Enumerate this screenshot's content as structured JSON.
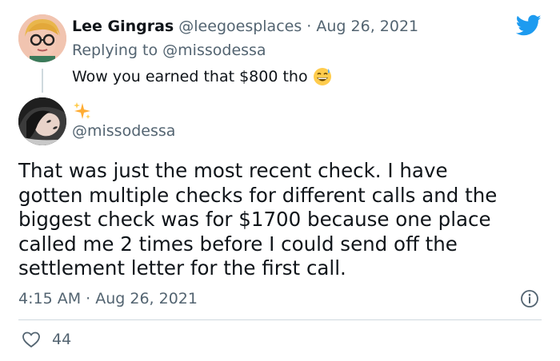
{
  "reply": {
    "name": "Lee Gingras",
    "handle": "@leegoesplaces",
    "separator": "·",
    "date": "Aug 26, 2021",
    "replying_prefix": "Replying to",
    "replying_to": "@missodessa",
    "text": "Wow you earned that $800 tho",
    "emoji": "grinning-sweat-emoji"
  },
  "main_tweet": {
    "display_name_icon": "sparkles-emoji",
    "handle": "@missodessa",
    "text_lines": [
      "That was just the most recent check.  I have",
      "gotten multiple checks for different calls and the",
      "biggest check was for $1700 because one place",
      "called me 2 times before I could send off the",
      "settlement letter for the first call."
    ],
    "timestamp": "4:15 AM · Aug 26, 2021",
    "likes_count": "44"
  },
  "icons": {
    "brand": "twitter-bird-icon",
    "info": "info-icon",
    "like": "heart-icon"
  },
  "colors": {
    "twitter_blue": "#1d9bf0",
    "secondary_text": "#536471",
    "primary_text": "#0f1419",
    "divider": "#cfd9de"
  }
}
